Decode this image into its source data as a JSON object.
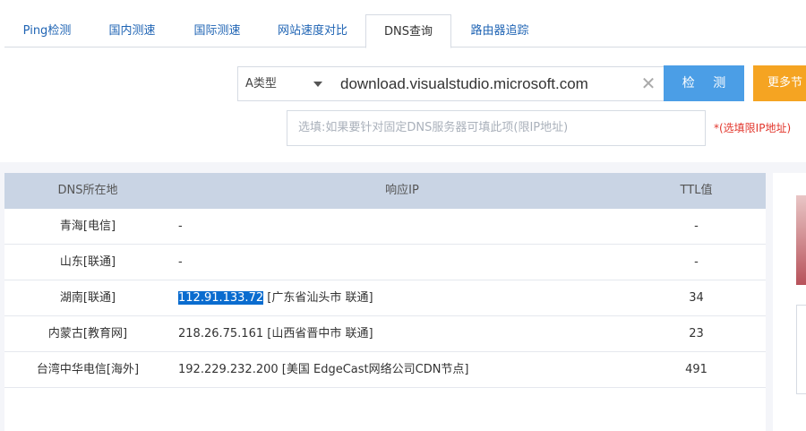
{
  "tabs": [
    {
      "label": "Ping检测"
    },
    {
      "label": "国内测速"
    },
    {
      "label": "国际测速"
    },
    {
      "label": "网站速度对比"
    },
    {
      "label": "DNS查询",
      "active": true
    },
    {
      "label": "路由器追踪"
    }
  ],
  "form": {
    "record_type": "A类型",
    "domain_value": "download.visualstudio.microsoft.com",
    "detect_button": "检 测",
    "more_button": "更多节",
    "dns_placeholder": "选填:如果要针对固定DNS服务器可填此项(限IP地址)",
    "dns_hint": "*(选填限IP地址)"
  },
  "table": {
    "headers": [
      "DNS所在地",
      "响应IP",
      "TTL值"
    ],
    "rows": [
      {
        "location": "青海[电信]",
        "ip": "-",
        "ip_info": "",
        "ttl": "-"
      },
      {
        "location": "山东[联通]",
        "ip": "-",
        "ip_info": "",
        "ttl": "-"
      },
      {
        "location": "湖南[联通]",
        "ip": "112.91.133.72",
        "ip_info": " [广东省汕头市 联通]",
        "ttl": "34",
        "selected": true
      },
      {
        "location": "内蒙古[教育网]",
        "ip": "218.26.75.161",
        "ip_info": " [山西省晋中市 联通]",
        "ttl": "23"
      },
      {
        "location": "台湾中华电信[海外]",
        "ip": "192.229.232.200",
        "ip_info": " [美国 EdgeCast网络公司CDN节点]",
        "ttl": "491"
      }
    ]
  },
  "colors": {
    "accent_blue": "#4b9ee6",
    "accent_orange": "#f5a422",
    "hint_red": "#e2362c",
    "selection": "#0a6ccf"
  },
  "icons": {
    "clear": "close-icon",
    "dropdown": "chevron-down-icon"
  }
}
